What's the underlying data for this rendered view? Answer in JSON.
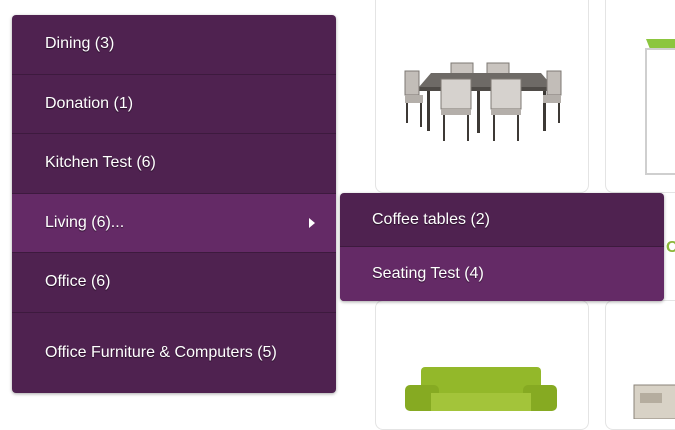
{
  "category_menu": {
    "items": [
      {
        "label": "Dining (3)"
      },
      {
        "label": "Donation (1)"
      },
      {
        "label": "Kitchen Test (6)"
      },
      {
        "label": "Living (6)..."
      },
      {
        "label": "Office (6)"
      },
      {
        "label": "Office Furniture & Computers (5)"
      }
    ],
    "active_item": "Living (6)...",
    "background_color": "#4f2250",
    "active_color": "#642a66"
  },
  "submenu": {
    "items": [
      {
        "label": "Coffee tables (2)"
      },
      {
        "label": "Seating Test (4)"
      }
    ],
    "highlighted_item": "Seating Test (4)"
  },
  "product_grid": {
    "visible_text_fragment": "O",
    "price_color": "#8cb73a",
    "images": [
      {
        "icon": "dining-table-set-image"
      },
      {
        "icon": "partial-product-image"
      },
      {
        "icon": "green-sofa-image"
      },
      {
        "icon": "partial-cabinet-image"
      }
    ]
  }
}
